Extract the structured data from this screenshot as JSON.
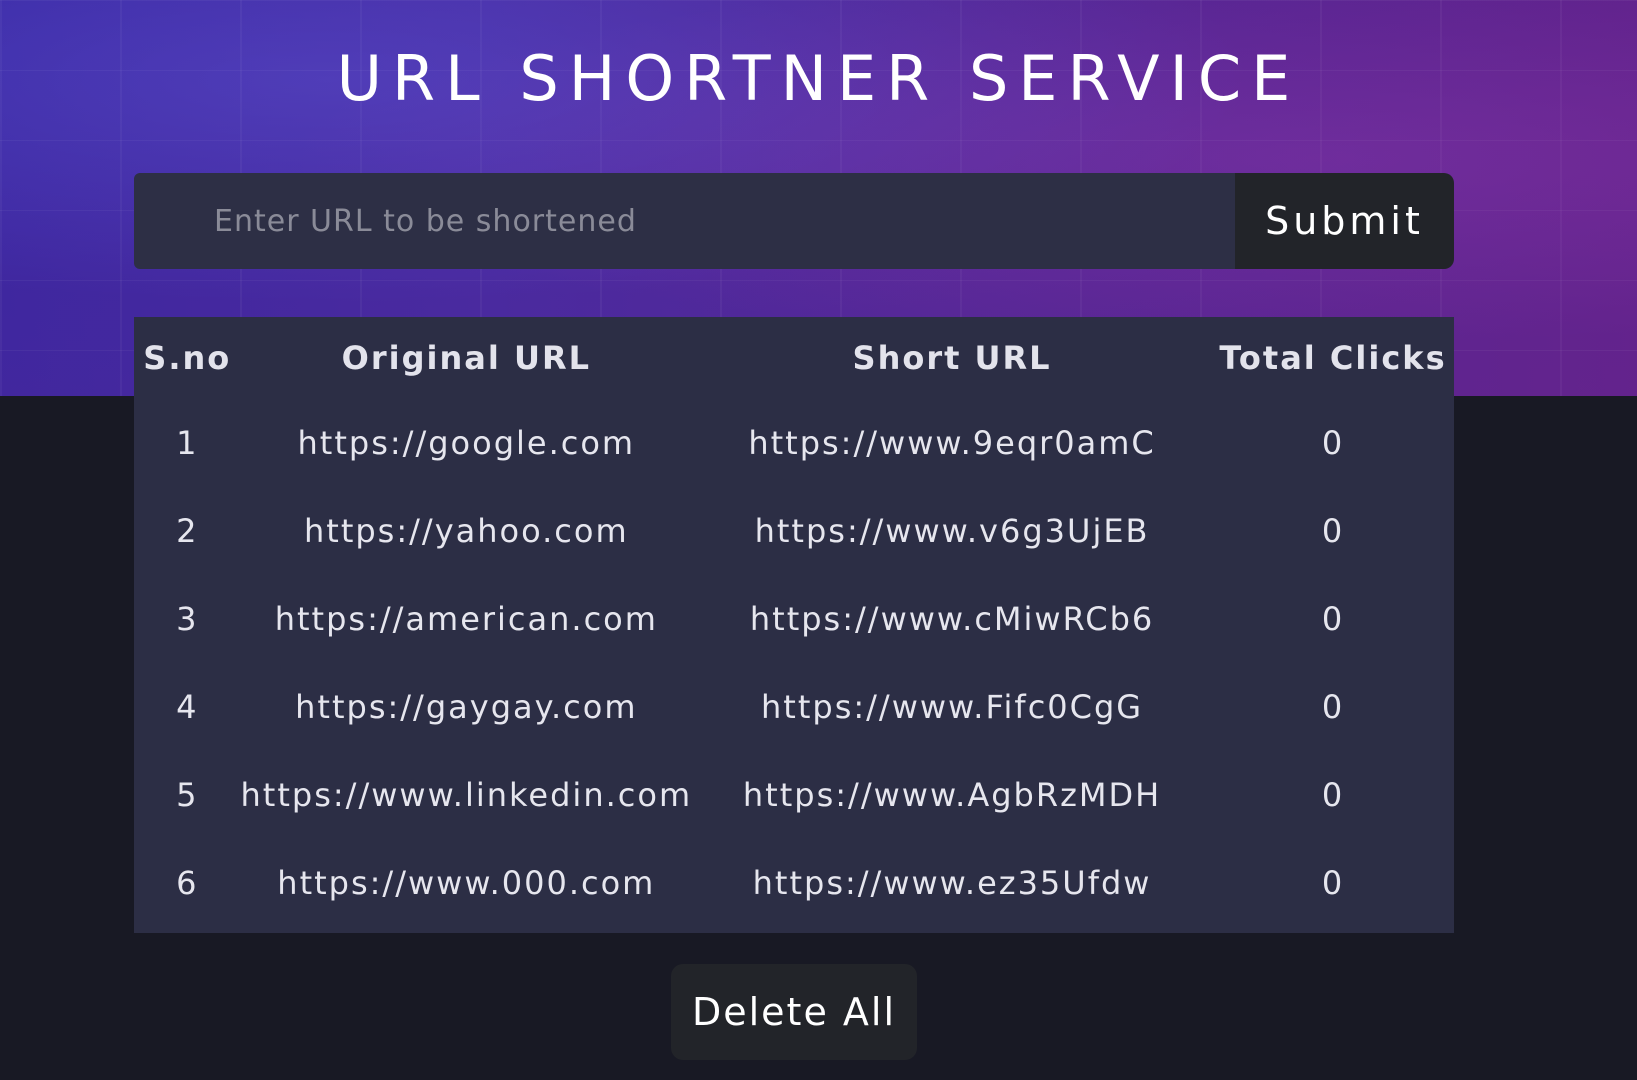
{
  "header": {
    "title": "URL SHORTNER SERVICE"
  },
  "form": {
    "input_placeholder": "Enter URL to be shortened",
    "input_value": "",
    "submit_label": "Submit"
  },
  "table": {
    "columns": [
      "S.no",
      "Original URL",
      "Short URL",
      "Total Clicks"
    ],
    "rows": [
      {
        "sno": "1",
        "original": "https://google.com",
        "short": "https://www.9eqr0amC",
        "clicks": "0"
      },
      {
        "sno": "2",
        "original": "https://yahoo.com",
        "short": "https://www.v6g3UjEB",
        "clicks": "0"
      },
      {
        "sno": "3",
        "original": "https://american.com",
        "short": "https://www.cMiwRCb6",
        "clicks": "0"
      },
      {
        "sno": "4",
        "original": "https://gaygay.com",
        "short": "https://www.Fifc0CgG",
        "clicks": "0"
      },
      {
        "sno": "5",
        "original": "https://www.linkedin.com",
        "short": "https://www.AgbRzMDH",
        "clicks": "0"
      },
      {
        "sno": "6",
        "original": "https://www.000.com",
        "short": "https://www.ez35Ufdw",
        "clicks": "0"
      }
    ]
  },
  "actions": {
    "delete_all_label": "Delete All"
  },
  "colors": {
    "page_background": "#181924",
    "hero_start": "#3c2aa8",
    "hero_end": "#6a2590",
    "panel": "#2c2e45",
    "button": "#222429"
  }
}
